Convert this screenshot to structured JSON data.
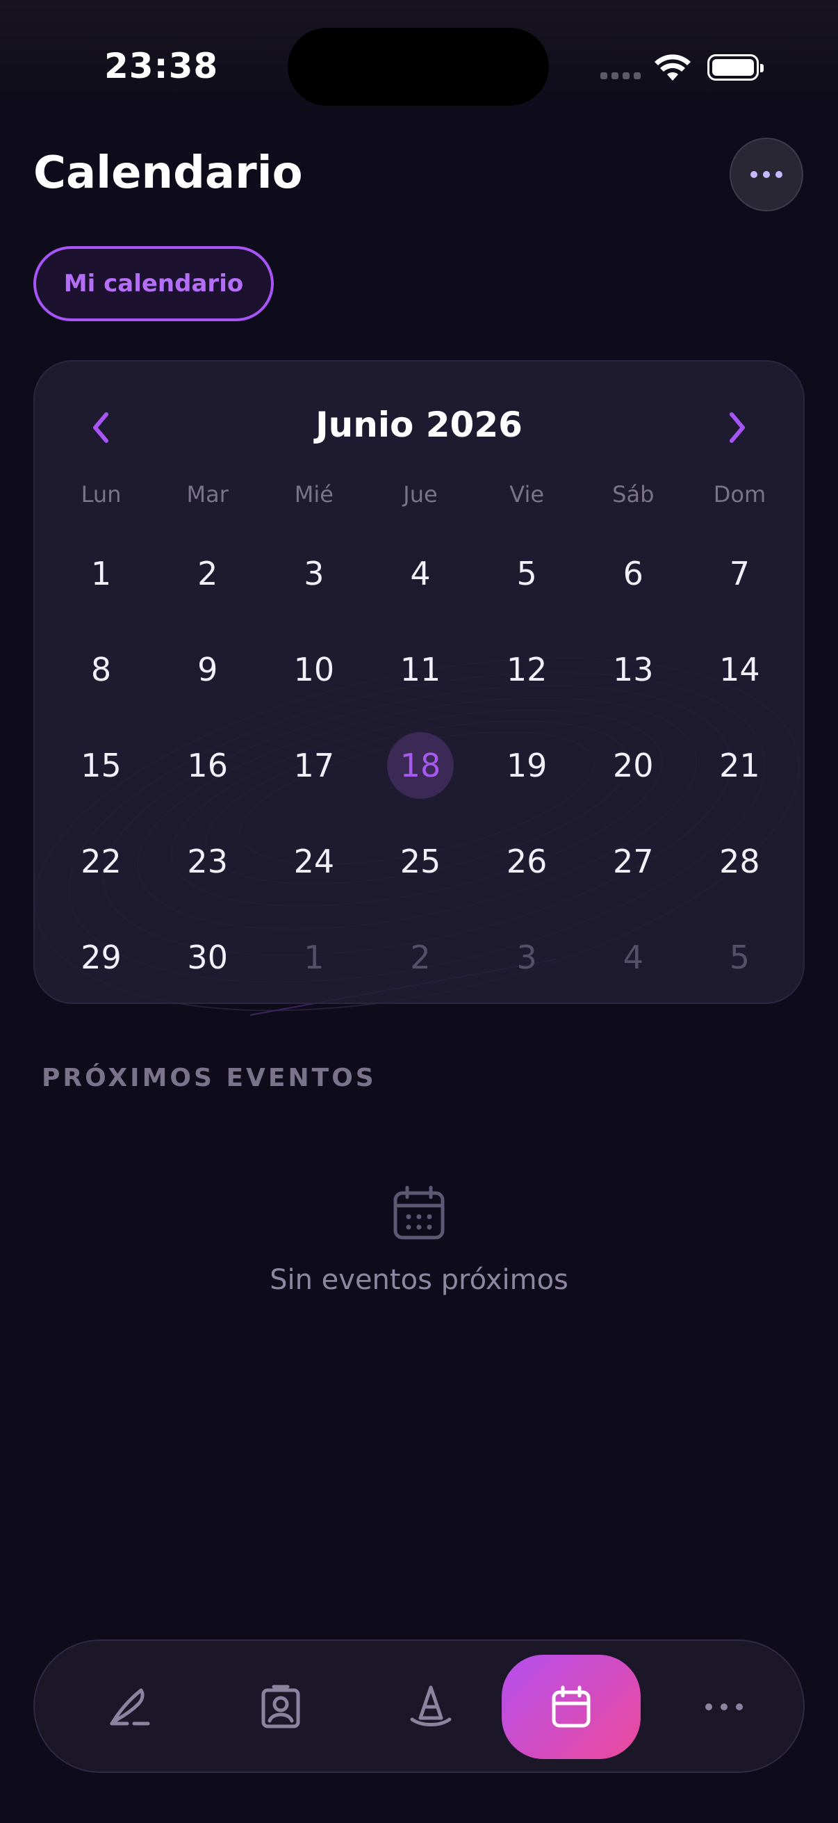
{
  "status": {
    "time": "23:38"
  },
  "header": {
    "title": "Calendario",
    "more_icon": "ellipsis-icon"
  },
  "filter": {
    "chip_label": "Mi calendario"
  },
  "calendar": {
    "month_title": "Junio 2026",
    "weekdays": [
      "Lun",
      "Mar",
      "Mié",
      "Jue",
      "Vie",
      "Sáb",
      "Dom"
    ],
    "days": [
      "1",
      "2",
      "3",
      "4",
      "5",
      "6",
      "7",
      "8",
      "9",
      "10",
      "11",
      "12",
      "13",
      "14",
      "15",
      "16",
      "17",
      "18",
      "19",
      "20",
      "21",
      "22",
      "23",
      "24",
      "25",
      "26",
      "27",
      "28",
      "29",
      "30",
      "1",
      "2",
      "3",
      "4",
      "5"
    ],
    "selected_day": "18",
    "accent": "#a855f7"
  },
  "events": {
    "section_title": "PRÓXIMOS EVENTOS",
    "empty_text": "Sin eventos próximos"
  },
  "tabbar": {
    "items": [
      {
        "icon": "feather-pen-icon"
      },
      {
        "icon": "contact-badge-icon"
      },
      {
        "icon": "wizard-hat-icon"
      },
      {
        "icon": "calendar-icon",
        "active": true
      },
      {
        "icon": "ellipsis-icon"
      }
    ]
  }
}
